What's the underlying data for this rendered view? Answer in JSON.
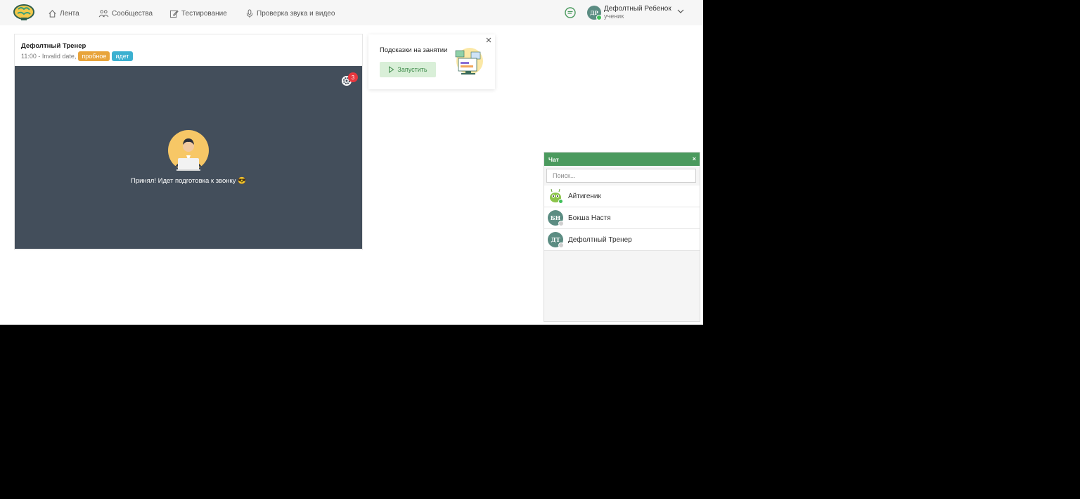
{
  "nav": {
    "items": [
      {
        "label": "Лента",
        "icon": "home-icon"
      },
      {
        "label": "Сообщества",
        "icon": "community-icon"
      },
      {
        "label": "Тестирование",
        "icon": "edit-icon"
      },
      {
        "label": "Проверка звука и видео",
        "icon": "microphone-icon"
      }
    ]
  },
  "user": {
    "initials": "ДР",
    "name": "Дефолтный Ребенок",
    "role": "ученик"
  },
  "lesson": {
    "title": "Дефолтный Тренер",
    "time": "11:00 - Invalid date,",
    "badge_trial": "пробное",
    "badge_status": "идет",
    "settings_count": "3",
    "call_status": "Принял! Идет подготовка к звонку 😎"
  },
  "hints": {
    "title": "Подсказки на занятии",
    "button": "Запустить"
  },
  "chat": {
    "title": "Чат",
    "close": "×",
    "search_placeholder": "Поиск...",
    "contacts": [
      {
        "name": "Айтигеник",
        "initials": "",
        "avatar_color": "#ffffff",
        "status_color": "#3fbf5a"
      },
      {
        "name": "Бокша Настя",
        "initials": "БН",
        "avatar_color": "#5b8c82",
        "status_color": "#cfcfcf"
      },
      {
        "name": "Дефолтный Тренер",
        "initials": "ДТ",
        "avatar_color": "#5b8c82",
        "status_color": "#cfcfcf"
      }
    ]
  },
  "colors": {
    "accent": "#4b9a5e",
    "video_bg": "#434e5b",
    "badge_trial": "#e8a43b",
    "badge_status": "#3bb0d0"
  }
}
